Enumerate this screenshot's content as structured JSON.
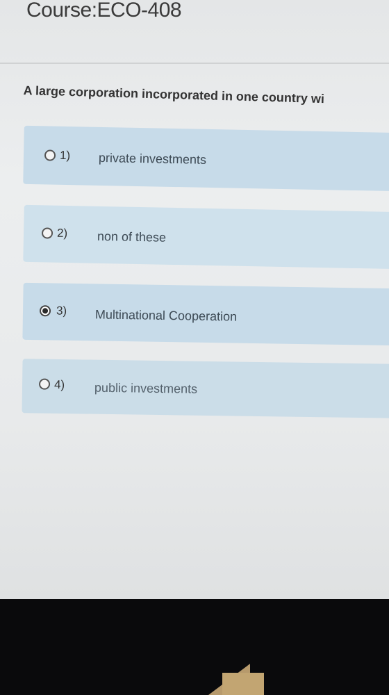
{
  "header": {
    "course_title": "Course:ECO-408"
  },
  "question": {
    "text": "A large corporation incorporated in one country wi"
  },
  "options": [
    {
      "number": "1)",
      "label": "private investments",
      "selected": false
    },
    {
      "number": "2)",
      "label": "non of these",
      "selected": false
    },
    {
      "number": "3)",
      "label": "Multinational Cooperation",
      "selected": true
    },
    {
      "number": "4)",
      "label": "public investments",
      "selected": false
    }
  ],
  "colors": {
    "option_background": "#c7dbe9",
    "page_background": "#eceeef",
    "bezel": "#0b0b0d"
  }
}
